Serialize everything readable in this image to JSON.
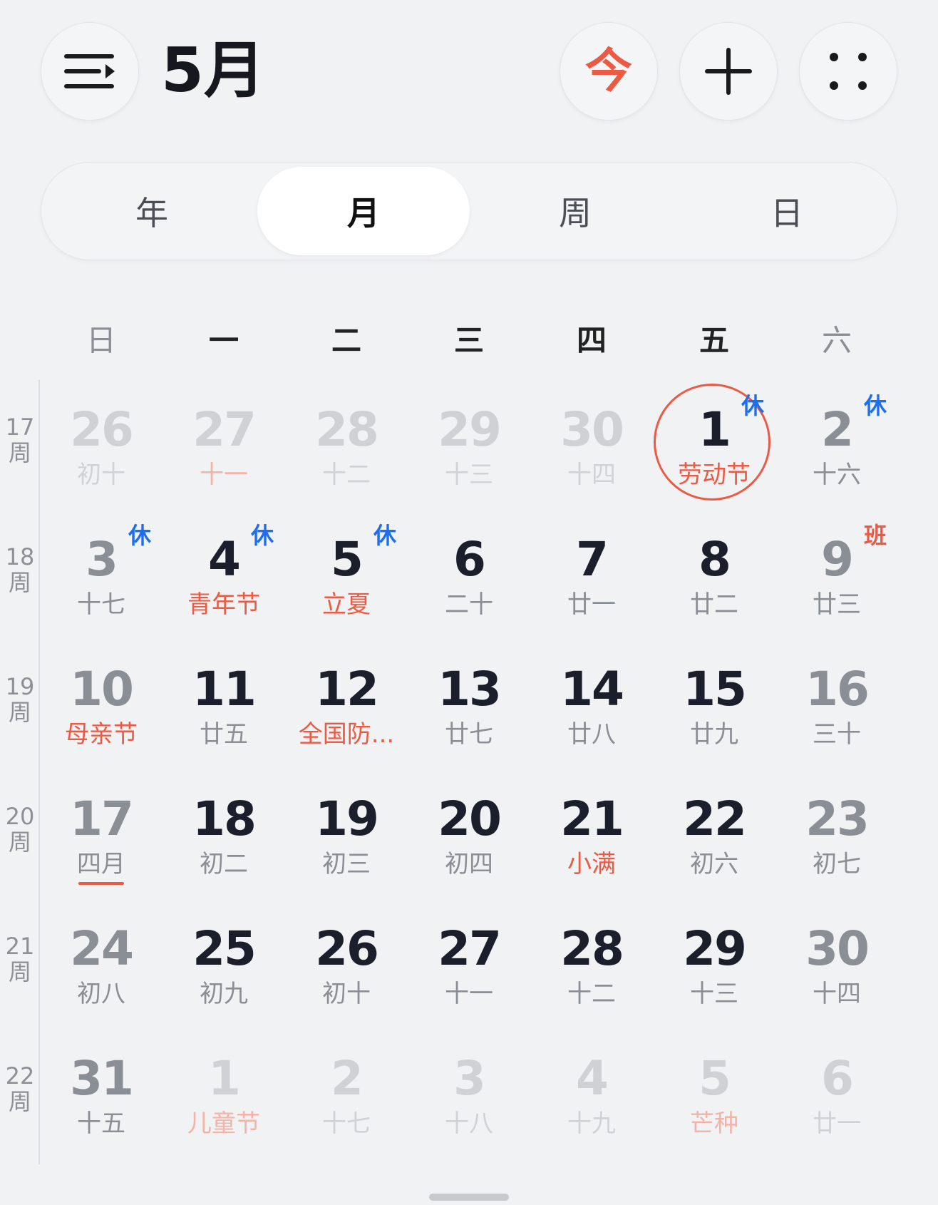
{
  "header": {
    "title": "5月",
    "today_label": "今",
    "colors": {
      "accent": "#ec5a43",
      "rest_badge": "#1f6ef0"
    }
  },
  "view_switcher": {
    "options": [
      {
        "label": "年",
        "active": false
      },
      {
        "label": "月",
        "active": true
      },
      {
        "label": "周",
        "active": false
      },
      {
        "label": "日",
        "active": false
      }
    ]
  },
  "weekdays": [
    "日",
    "一",
    "二",
    "三",
    "四",
    "五",
    "六"
  ],
  "week_numbers": [
    "17\n周",
    "18\n周",
    "19\n周",
    "20\n周",
    "21\n周",
    "22\n周"
  ],
  "weeks": [
    [
      {
        "day": "26",
        "sub": "初十",
        "kind": "other"
      },
      {
        "day": "27",
        "sub": "十一",
        "kind": "other",
        "sub_red": true
      },
      {
        "day": "28",
        "sub": "十二",
        "kind": "other"
      },
      {
        "day": "29",
        "sub": "十三",
        "kind": "other"
      },
      {
        "day": "30",
        "sub": "十四",
        "kind": "other"
      },
      {
        "day": "1",
        "sub": "劳动节",
        "kind": "today",
        "sub_red": true,
        "badge": "休",
        "badge_type": "rest"
      },
      {
        "day": "2",
        "sub": "十六",
        "kind": "weekend",
        "badge": "休",
        "badge_type": "rest"
      }
    ],
    [
      {
        "day": "3",
        "sub": "十七",
        "kind": "weekend",
        "badge": "休",
        "badge_type": "rest"
      },
      {
        "day": "4",
        "sub": "青年节",
        "kind": "normal",
        "sub_red": true,
        "badge": "休",
        "badge_type": "rest"
      },
      {
        "day": "5",
        "sub": "立夏",
        "kind": "normal",
        "sub_red": true,
        "badge": "休",
        "badge_type": "rest"
      },
      {
        "day": "6",
        "sub": "二十",
        "kind": "normal"
      },
      {
        "day": "7",
        "sub": "廿一",
        "kind": "normal"
      },
      {
        "day": "8",
        "sub": "廿二",
        "kind": "normal"
      },
      {
        "day": "9",
        "sub": "廿三",
        "kind": "weekend",
        "badge": "班",
        "badge_type": "work"
      }
    ],
    [
      {
        "day": "10",
        "sub": "母亲节",
        "kind": "weekend",
        "sub_red": true
      },
      {
        "day": "11",
        "sub": "廿五",
        "kind": "normal"
      },
      {
        "day": "12",
        "sub": "全国防...",
        "kind": "normal",
        "sub_red": true
      },
      {
        "day": "13",
        "sub": "廿七",
        "kind": "normal"
      },
      {
        "day": "14",
        "sub": "廿八",
        "kind": "normal"
      },
      {
        "day": "15",
        "sub": "廿九",
        "kind": "normal"
      },
      {
        "day": "16",
        "sub": "三十",
        "kind": "weekend"
      }
    ],
    [
      {
        "day": "17",
        "sub": "四月",
        "kind": "weekend",
        "underline": true
      },
      {
        "day": "18",
        "sub": "初二",
        "kind": "normal"
      },
      {
        "day": "19",
        "sub": "初三",
        "kind": "normal"
      },
      {
        "day": "20",
        "sub": "初四",
        "kind": "normal"
      },
      {
        "day": "21",
        "sub": "小满",
        "kind": "normal",
        "sub_red": true
      },
      {
        "day": "22",
        "sub": "初六",
        "kind": "normal"
      },
      {
        "day": "23",
        "sub": "初七",
        "kind": "weekend"
      }
    ],
    [
      {
        "day": "24",
        "sub": "初八",
        "kind": "weekend"
      },
      {
        "day": "25",
        "sub": "初九",
        "kind": "normal"
      },
      {
        "day": "26",
        "sub": "初十",
        "kind": "normal"
      },
      {
        "day": "27",
        "sub": "十一",
        "kind": "normal"
      },
      {
        "day": "28",
        "sub": "十二",
        "kind": "normal"
      },
      {
        "day": "29",
        "sub": "十三",
        "kind": "normal"
      },
      {
        "day": "30",
        "sub": "十四",
        "kind": "weekend"
      }
    ],
    [
      {
        "day": "31",
        "sub": "十五",
        "kind": "weekend"
      },
      {
        "day": "1",
        "sub": "儿童节",
        "kind": "other",
        "sub_red": true
      },
      {
        "day": "2",
        "sub": "十七",
        "kind": "other"
      },
      {
        "day": "3",
        "sub": "十八",
        "kind": "other"
      },
      {
        "day": "4",
        "sub": "十九",
        "kind": "other"
      },
      {
        "day": "5",
        "sub": "芒种",
        "kind": "other",
        "sub_red": true
      },
      {
        "day": "6",
        "sub": "廿一",
        "kind": "other"
      }
    ]
  ]
}
